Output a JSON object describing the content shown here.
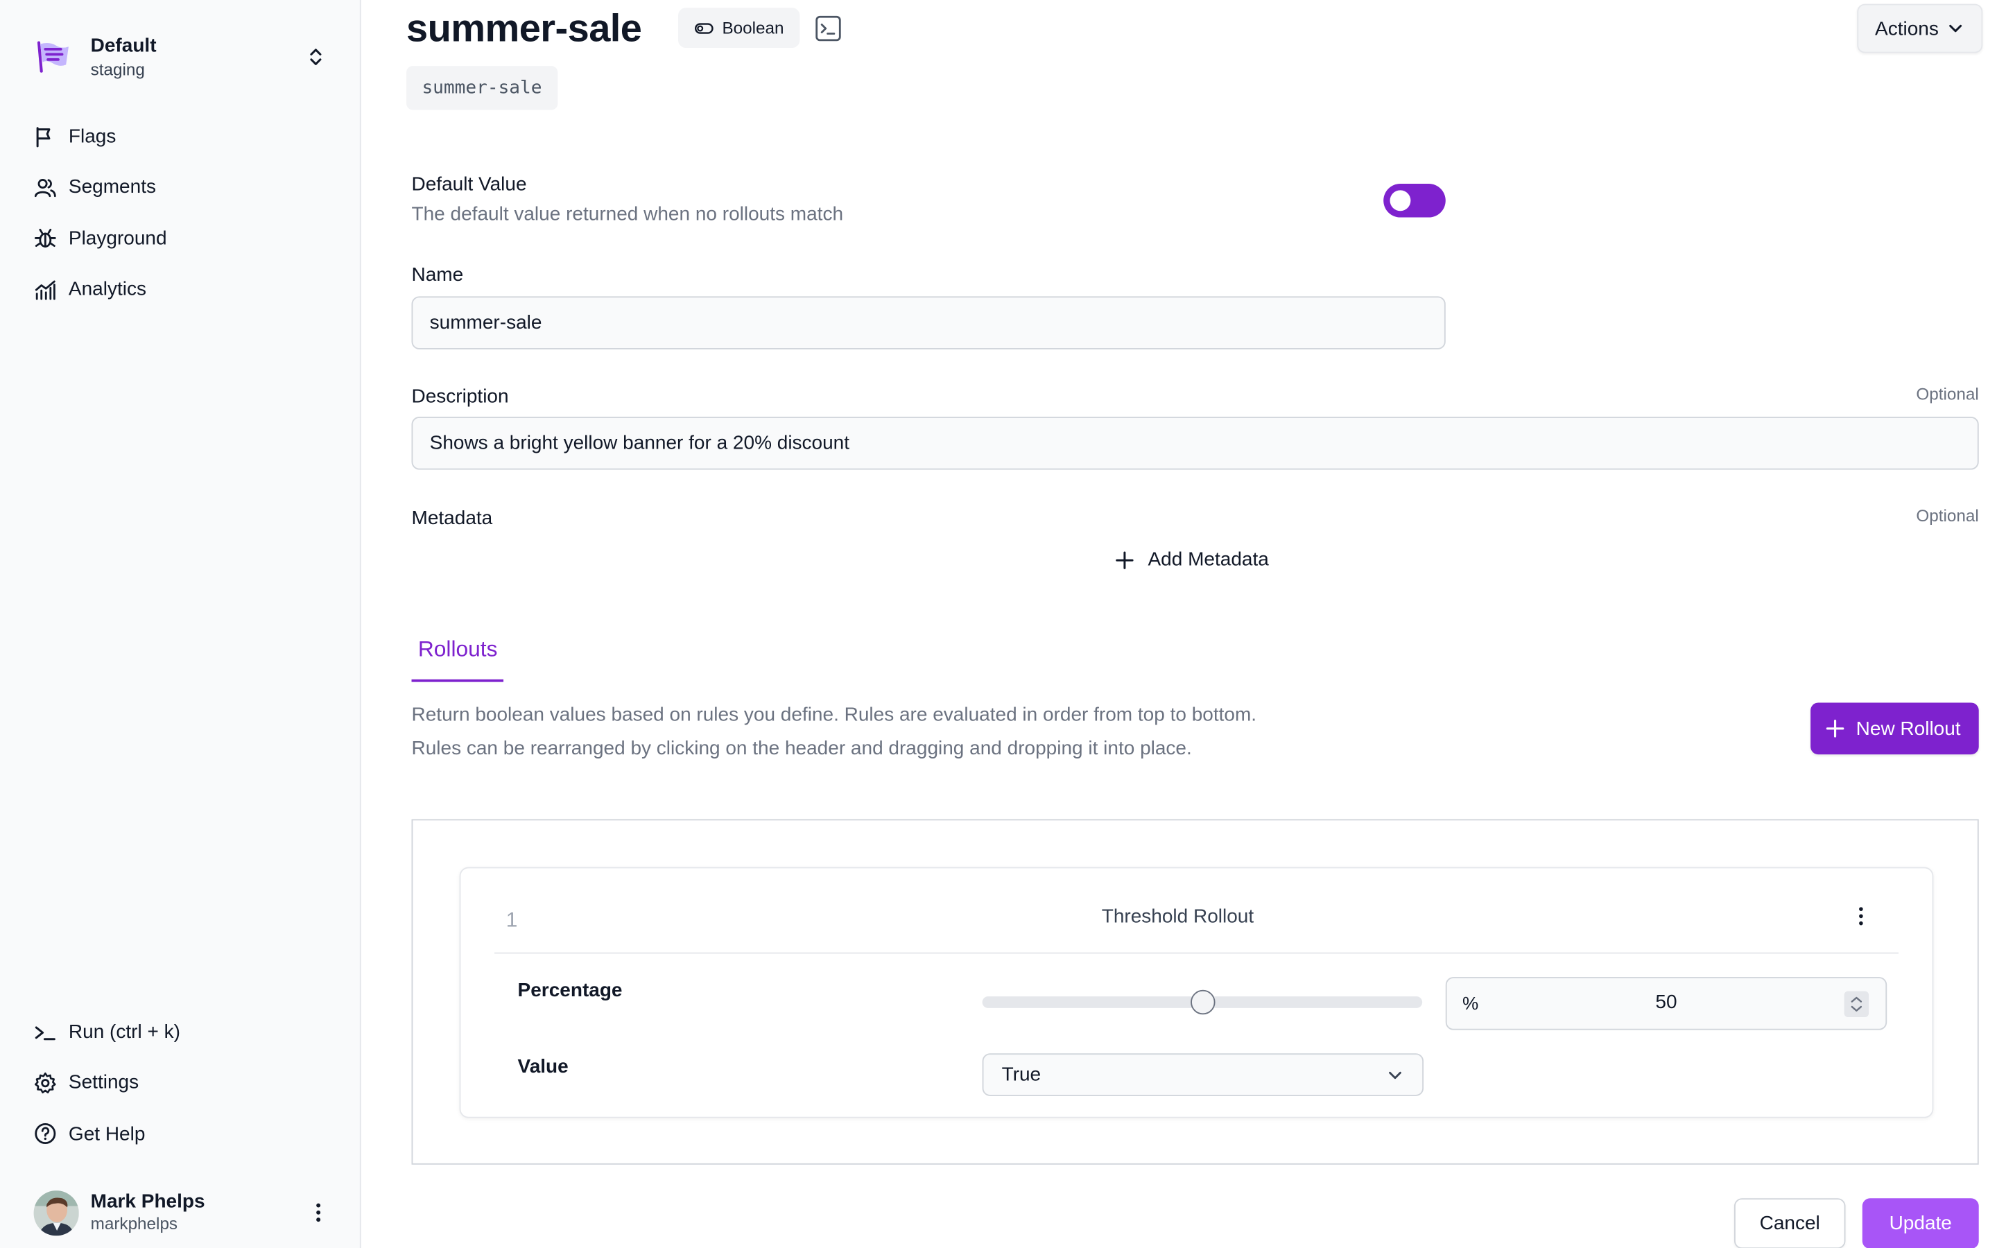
{
  "namespace": {
    "name": "Default",
    "environment": "staging"
  },
  "sidebar": {
    "nav": [
      {
        "label": "Flags",
        "icon": "flag-icon"
      },
      {
        "label": "Segments",
        "icon": "users-icon"
      },
      {
        "label": "Playground",
        "icon": "bug-icon"
      },
      {
        "label": "Analytics",
        "icon": "chart-icon"
      }
    ],
    "bottom": [
      {
        "label": "Run (ctrl + k)",
        "icon": "terminal-prompt-icon"
      },
      {
        "label": "Settings",
        "icon": "gear-icon"
      },
      {
        "label": "Get Help",
        "icon": "help-circle-icon"
      }
    ],
    "user": {
      "name": "Mark Phelps",
      "login": "markphelps"
    }
  },
  "header": {
    "title": "summer-sale",
    "type_badge": "Boolean",
    "key": "summer-sale",
    "actions_label": "Actions"
  },
  "form": {
    "default_value": {
      "label": "Default Value",
      "help": "The default value returned when no rollouts match",
      "enabled": true
    },
    "name": {
      "label": "Name",
      "value": "summer-sale"
    },
    "description": {
      "label": "Description",
      "optional": "Optional",
      "value": "Shows a bright yellow banner for a 20% discount"
    },
    "metadata": {
      "label": "Metadata",
      "optional": "Optional",
      "add_label": "Add Metadata"
    }
  },
  "rollouts": {
    "tab_label": "Rollouts",
    "description_line1": "Return boolean values based on rules you define. Rules are evaluated in order from top to bottom.",
    "description_line2": "Rules can be rearranged by clicking on the header and dragging and dropping it into place.",
    "new_button": "New Rollout",
    "items": [
      {
        "index": "1",
        "title": "Threshold Rollout",
        "percentage_label": "Percentage",
        "percentage_sign": "%",
        "percentage": "50",
        "value_label": "Value",
        "value": "True"
      }
    ]
  },
  "footer": {
    "cancel": "Cancel",
    "update": "Update"
  },
  "colors": {
    "accent": "#7e22ce",
    "accent_light": "#a855f7"
  }
}
